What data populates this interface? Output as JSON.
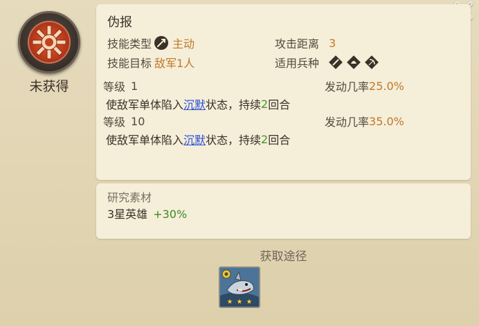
{
  "skill": {
    "name": "伪报",
    "status": "未获得",
    "type_label": "技能类型",
    "type_value": "主动",
    "range_label": "攻击距离",
    "range_value": "3",
    "target_label": "技能目标",
    "target_value": "敌军1人",
    "troop_label": "适用兵种",
    "troop_icons": [
      "sword-icon",
      "helmet-icon",
      "bow-icon"
    ]
  },
  "levels": [
    {
      "level_label": "等级",
      "level_value": "1",
      "chance_label": "发动几率",
      "chance_value": "25.0%",
      "desc_prefix": "使敌军单体陷入",
      "desc_link": "沉默",
      "desc_mid": "状态，持续",
      "desc_num": "2",
      "desc_suffix": "回合"
    },
    {
      "level_label": "等级",
      "level_value": "10",
      "chance_label": "发动几率",
      "chance_value": "35.0%",
      "desc_prefix": "使敌军单体陷入",
      "desc_link": "沉默",
      "desc_mid": "状态，持续",
      "desc_num": "2",
      "desc_suffix": "回合"
    }
  ],
  "material": {
    "title": "研究素材",
    "value": "3星英雄",
    "bonus": "+30%"
  },
  "source": {
    "title": "获取途径",
    "hero_stars": 3
  },
  "colors": {
    "accent": "#c0782a",
    "green": "#3f9a2a",
    "link": "#2a4fd6"
  }
}
